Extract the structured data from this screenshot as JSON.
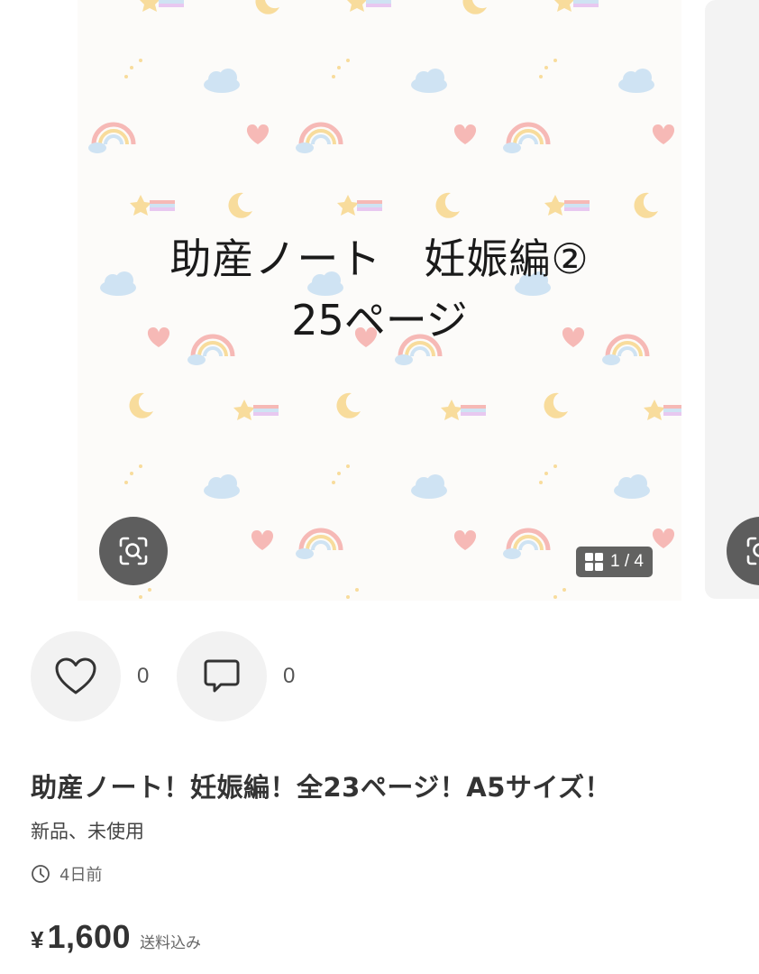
{
  "gallery": {
    "caption_line1": "助産ノート　妊娠編②",
    "caption_line2": "25ページ",
    "counter": "1 / 4",
    "zoom_icon": "zoom-scan-icon",
    "grid_icon": "grid-icon"
  },
  "actions": {
    "like_icon": "heart-icon",
    "like_count": "0",
    "comment_icon": "comment-icon",
    "comment_count": "0"
  },
  "item": {
    "title": "助産ノート！妊娠編！全23ページ！A5サイズ！",
    "condition": "新品、未使用",
    "posted": "4日前",
    "posted_icon": "clock-icon",
    "price_currency": "¥",
    "price": "1,600",
    "shipping_note": "送料込み"
  },
  "colors": {
    "pattern_pink": "#f6b9b6",
    "pattern_yellow": "#f8dc9c",
    "pattern_blue": "#cfe3f3",
    "overlay": "#505050"
  }
}
